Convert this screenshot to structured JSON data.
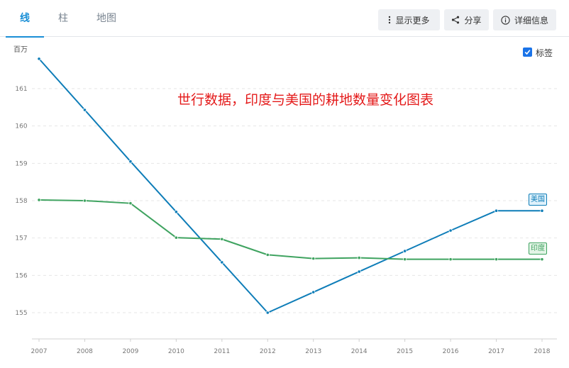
{
  "tabs": [
    {
      "label": "线",
      "active": true
    },
    {
      "label": "柱",
      "active": false
    },
    {
      "label": "地图",
      "active": false
    }
  ],
  "actions": {
    "show_more": "显示更多",
    "share": "分享",
    "details": "详细信息"
  },
  "legend": {
    "label": "标签",
    "checked": true
  },
  "colors": {
    "us": "#0e7db8",
    "india": "#3fa360",
    "accent": "#1a8fd6",
    "title": "#e41a1a"
  },
  "chart_data": {
    "type": "line",
    "title": "世行数据，印度与美国的耕地数量变化图表",
    "ylabel": "百万",
    "ylim": [
      154.5,
      162.0
    ],
    "yticks": [
      155,
      156,
      157,
      158,
      159,
      160,
      161
    ],
    "x": [
      "2007",
      "2008",
      "2009",
      "2010",
      "2011",
      "2012",
      "2013",
      "2014",
      "2015",
      "2016",
      "2017",
      "2018"
    ],
    "series": [
      {
        "name": "美国",
        "key": "us",
        "values": [
          161.8,
          160.43,
          159.05,
          157.7,
          156.35,
          155.0,
          155.55,
          156.1,
          156.65,
          157.2,
          157.73,
          157.73
        ]
      },
      {
        "name": "印度",
        "key": "india",
        "values": [
          158.02,
          158.0,
          157.93,
          157.01,
          156.97,
          156.55,
          156.45,
          156.47,
          156.43,
          156.43,
          156.43,
          156.43
        ]
      }
    ]
  }
}
